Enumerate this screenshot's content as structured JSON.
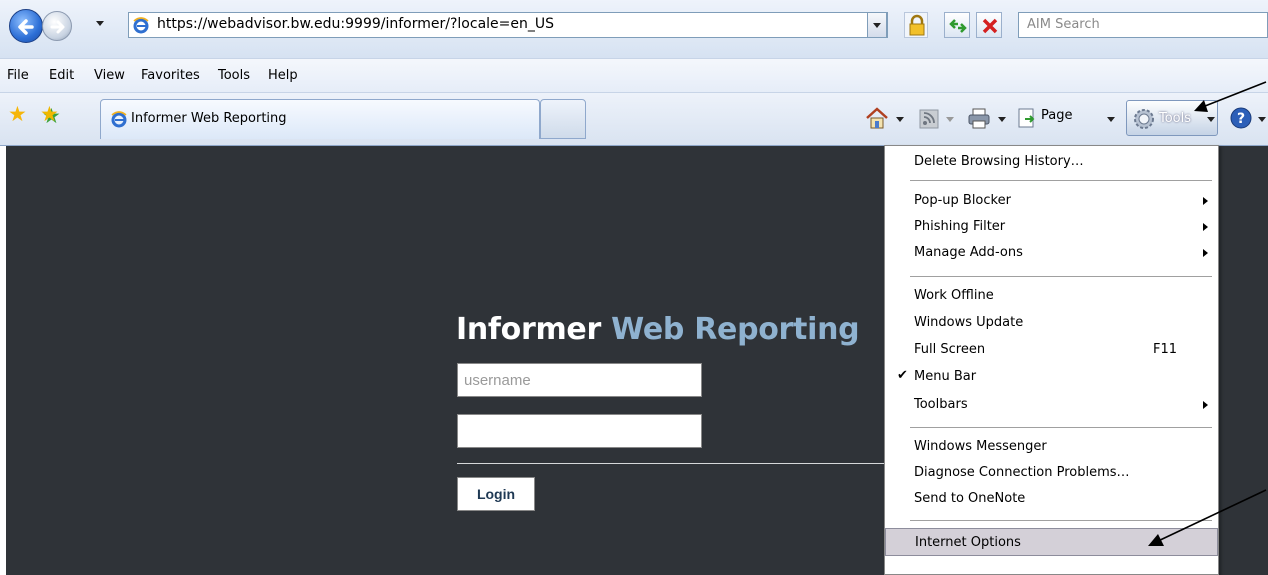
{
  "browser": {
    "url": "https://webadvisor.bw.edu:9999/informer/?locale=en_US",
    "search_placeholder": "AIM Search",
    "menu": [
      "File",
      "Edit",
      "View",
      "Favorites",
      "Tools",
      "Help"
    ],
    "tab_title": "Informer Web Reporting",
    "command_bar": {
      "page_label": "Page",
      "tools_label": "Tools"
    }
  },
  "login": {
    "title_part1": "Informer",
    "title_part2": "Web Reporting",
    "username_placeholder": "username",
    "login_label": "Login"
  },
  "tools_menu": {
    "items": [
      {
        "label": "Delete Browsing History…"
      },
      {
        "label": "Pop-up Blocker"
      },
      {
        "label": "Phishing Filter"
      },
      {
        "label": "Manage Add-ons"
      },
      {
        "label": "Work Offline"
      },
      {
        "label": "Windows Update"
      },
      {
        "label": "Full Screen",
        "shortcut": "F11"
      },
      {
        "label": "Menu Bar",
        "checked": true
      },
      {
        "label": "Toolbars"
      },
      {
        "label": "Windows Messenger"
      },
      {
        "label": "Diagnose Connection Problems…"
      },
      {
        "label": "Send to OneNote"
      },
      {
        "label": "Internet Options",
        "highlighted": true
      }
    ]
  },
  "colors": {
    "page_background": "#2f3338",
    "title_accent": "#8fb2d0",
    "menu_highlight": "#d4d0d8"
  }
}
